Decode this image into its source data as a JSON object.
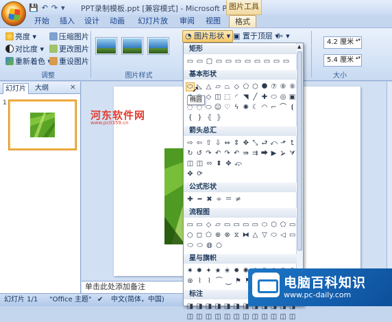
{
  "window": {
    "title": "PPT录制模板.ppt [兼容模式] - Microsoft PowerP...",
    "context_tab_title": "图片工具"
  },
  "tabs": [
    "开始",
    "插入",
    "设计",
    "动画",
    "幻灯片放映",
    "审阅",
    "视图",
    "格式"
  ],
  "ribbon": {
    "adjust_group": {
      "label": "调整",
      "items": [
        "亮度",
        "对比度",
        "重新着色",
        "压缩图片",
        "更改图片",
        "重设图片"
      ]
    },
    "styles_group": {
      "label": "图片样式"
    },
    "shape_button": "图片形状",
    "front_button": "置于顶层",
    "size_group": {
      "label": "大小",
      "height": "4.2 厘米",
      "width": "5.4 厘米"
    }
  },
  "left_panel": {
    "tabs": [
      "幻灯片",
      "大纲"
    ],
    "close": "×",
    "slide_number": "1"
  },
  "notes_placeholder": "单击此处添加备注",
  "status_bar": {
    "slide_info": "幻灯片 1/1",
    "theme": "\"Office 主题\"",
    "language": "中文(简体，中国)"
  },
  "dropdown": {
    "sections": [
      {
        "title": "矩形",
        "rows": [
          [
            "▭",
            "▭",
            "▢",
            "▭",
            "▭",
            "▭",
            "▭",
            "▭",
            "▭",
            "▭",
            "▭"
          ]
        ]
      },
      {
        "title": "基本形状",
        "rows": [
          [
            "⬭",
            "◺",
            "△",
            "▱",
            "⏢",
            "◇",
            "⬠",
            "⬡",
            "⯃",
            "⑦",
            "⑧",
            "⑧"
          ],
          [
            "◔",
            "◠",
            "◇",
            "◫",
            "⬚",
            "◜",
            "◥",
            "╱",
            "✚",
            "⬭",
            "◎",
            "▣"
          ],
          [
            "◌",
            "◌",
            "⬭",
            "☺",
            "♡",
            "ϟ",
            "✺",
            "☾",
            "◠",
            "⌐",
            "⌒",
            "⦗"
          ],
          [
            "{",
            "}",
            "⦃",
            "⦄"
          ]
        ]
      },
      {
        "title": "箭头总汇",
        "rows": [
          [
            "⇨",
            "⇦",
            "⇧",
            "⇩",
            "⇔",
            "⇕",
            "✥",
            "⤡",
            "⮐",
            "⤺",
            "⬏",
            "⮤"
          ],
          [
            "↻",
            "↺",
            "↷",
            "↶",
            "↷",
            "↶",
            "⇛",
            "⇉",
            "⮕",
            "▶",
            "⮚",
            "⮛"
          ],
          [
            "◫",
            "◫",
            "⬄",
            "⬍",
            "✥",
            "⤽"
          ],
          [
            "✥",
            "⟳"
          ]
        ]
      },
      {
        "title": "公式形状",
        "rows": [
          [
            "✚",
            "━",
            "✖",
            "÷",
            "＝",
            "≠"
          ]
        ]
      },
      {
        "title": "流程图",
        "rows": [
          [
            "▭",
            "▭",
            "◇",
            "▱",
            "▭",
            "▭",
            "▭",
            "▭",
            "⬭",
            "⬡",
            "⬠",
            "▭"
          ],
          [
            "○",
            "◻",
            "⬠",
            "⊕",
            "⊗",
            "⧖",
            "⧓",
            "△",
            "▽",
            "⬭",
            "◁",
            "▭"
          ],
          [
            "⬭",
            "⬭",
            "◍",
            "○"
          ]
        ]
      },
      {
        "title": "星与旗帜",
        "rows": [
          [
            "✷",
            "✸",
            "✦",
            "★",
            "✬",
            "✹",
            "✺",
            "✹",
            "✺",
            "✹",
            "✺",
            "✺"
          ],
          [
            "⊛",
            "⌇",
            "⌇",
            "⏜",
            "⏝",
            "⚑",
            "⚑",
            "⚐",
            "⚐"
          ]
        ]
      },
      {
        "title": "标注",
        "rows": [
          [
            "◨",
            "◨",
            "◨",
            "◨",
            "◨",
            "◨",
            "◨",
            "◨",
            "◨",
            "◨",
            "◨",
            "◨"
          ],
          [
            "◫",
            "◫",
            "◫",
            "◫",
            "◫",
            "◫",
            "◫",
            "◫",
            "◫",
            "◫",
            "◫",
            "◫"
          ]
        ]
      }
    ],
    "tooltip": "椭圆"
  },
  "watermarks": {
    "top_left": "河东软件网",
    "top_left_url": "www.pc0359.cn",
    "bottom_right_title": "电脑百科知识",
    "bottom_right_url": "www.pc-daily.com"
  },
  "colors": {
    "accent": "#f6c869",
    "ribbon": "#d6e4f6",
    "watermark_blue": "#1d77c9"
  }
}
